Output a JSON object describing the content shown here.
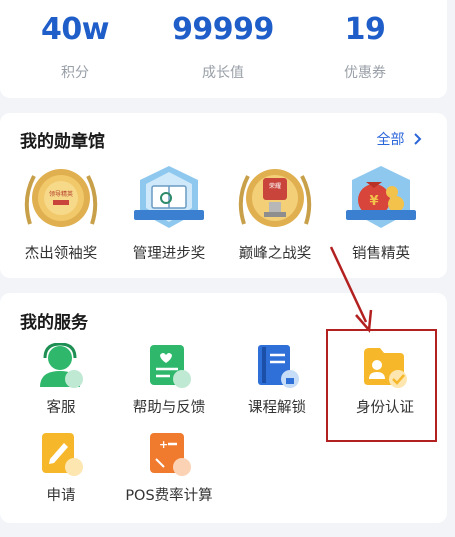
{
  "stats": [
    {
      "value": "40w",
      "label": "积分"
    },
    {
      "value": "99999",
      "label": "成长值"
    },
    {
      "value": "19",
      "label": "优惠券"
    }
  ],
  "badges": {
    "title": "我的勋章馆",
    "view_all": "全部",
    "items": [
      {
        "label": "杰出领袖奖",
        "icon": "gold-medal-icon",
        "emblem": "领导精英"
      },
      {
        "label": "管理进步奖",
        "icon": "blue-book-medal-icon"
      },
      {
        "label": "巅峰之战奖",
        "icon": "trophy-medal-icon",
        "emblem": "荣耀"
      },
      {
        "label": "销售精英",
        "icon": "money-bag-medal-icon"
      }
    ]
  },
  "services": {
    "title": "我的服务",
    "items": [
      {
        "label": "客服",
        "icon": "customer-service-icon"
      },
      {
        "label": "帮助与反馈",
        "icon": "help-feedback-icon"
      },
      {
        "label": "课程解锁",
        "icon": "course-unlock-icon"
      },
      {
        "label": "身份认证",
        "icon": "identity-verify-icon"
      },
      {
        "label": "申请",
        "icon": "apply-icon"
      },
      {
        "label": "POS费率计算",
        "icon": "pos-calculator-icon"
      }
    ]
  },
  "colors": {
    "accent": "#1f5ec9",
    "link": "#2b66d9",
    "annotation": "#b32020"
  }
}
